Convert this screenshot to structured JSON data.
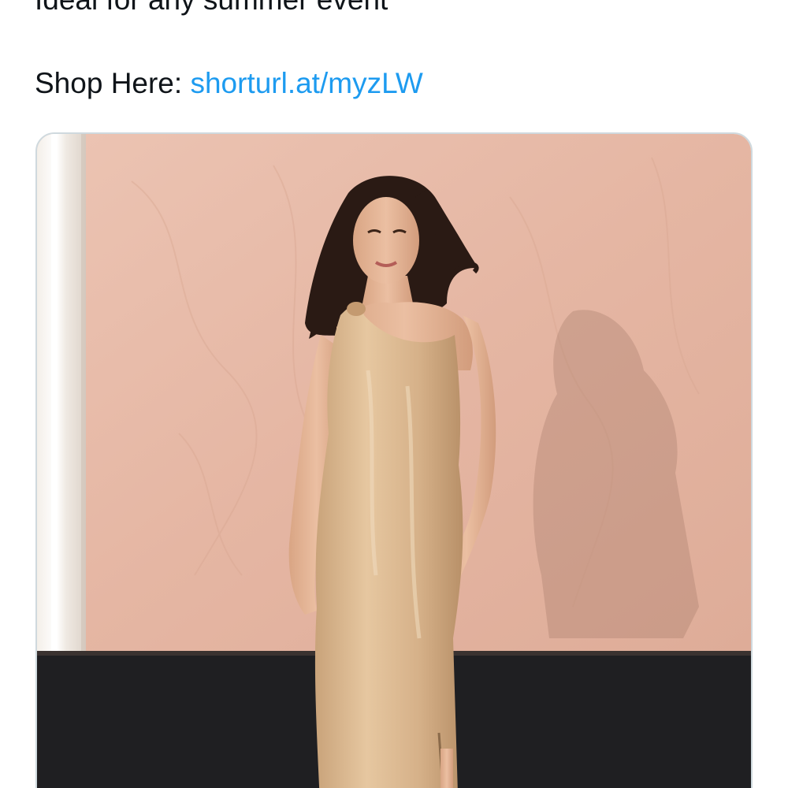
{
  "tweet": {
    "partial_line": "Ideal for any summer event",
    "shop_prefix": "Shop Here: ",
    "shop_link": "shorturl.at/myzLW"
  },
  "media": {
    "description": "Model in a champagne satin one-shoulder maxi dress against a blush pink wood wall",
    "colors": {
      "wall": "#e8bcaa",
      "floor": "#1f1f22",
      "dress": "#d8b48c",
      "skin": "#e6b89c",
      "hair": "#2a1a14",
      "link": "#1d9bf0"
    }
  }
}
